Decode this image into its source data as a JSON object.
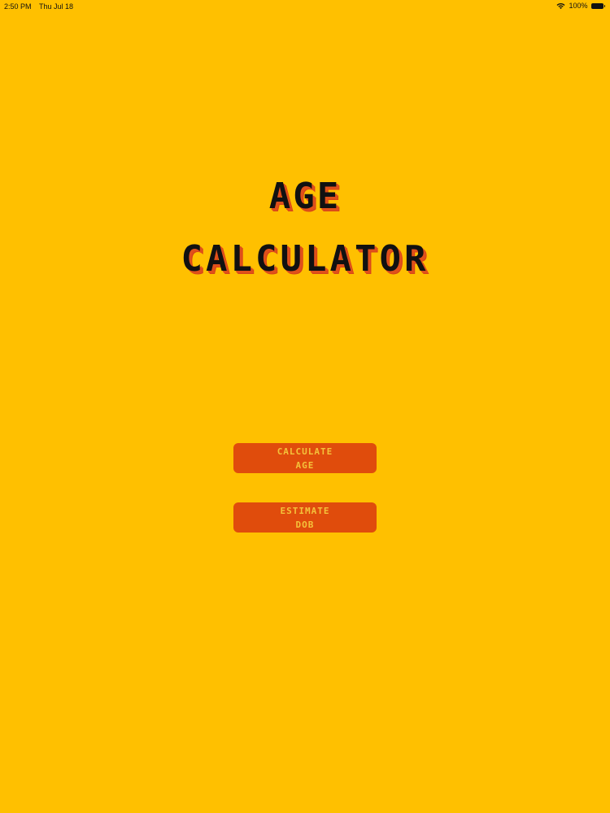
{
  "status_bar": {
    "time": "2:50 PM",
    "date": "Thu Jul 18",
    "battery": "100%",
    "icons": [
      "wifi-icon",
      "battery-icon"
    ]
  },
  "title": {
    "line1": "AGE",
    "line2": "CALCULATOR"
  },
  "buttons": {
    "calculate_age": {
      "line1": "CALCULATE",
      "line2": "AGE"
    },
    "estimate_dob": {
      "line1": "ESTIMATE",
      "line2": "DOB"
    }
  },
  "colors": {
    "background": "#FFC000",
    "button": "#E04C0C",
    "button_text": "#F4C23A",
    "title_text": "#111111",
    "title_shadow": "#E0501B"
  }
}
